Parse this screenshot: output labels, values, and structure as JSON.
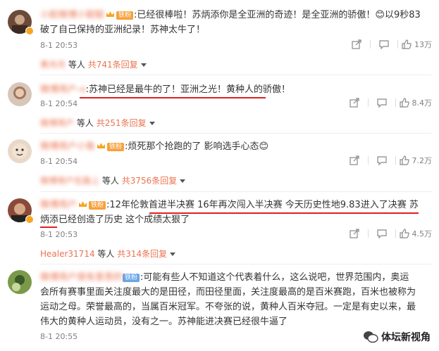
{
  "comments": [
    {
      "username": "小脸微博小聪聪",
      "fan_badge": "铁粉",
      "text": ":已经很棒啦！苏炳添你是全亚洲的奇迹！是全亚洲的骄傲！😊以9秒83破了自己保持的亚洲纪录！苏神太牛了！",
      "time": "8-1 20:53",
      "likes": "13万",
      "reply_user": "黄月月",
      "reply_text": "等人",
      "reply_count": "共741条回复"
    },
    {
      "username": "微博用户-o",
      "fan_badge": "",
      "text": ":苏神已经是最牛的了！亚洲之光！黄种人的骄傲！",
      "time": "8-1 20:54",
      "likes": "8.4万",
      "reply_user": "微博用户",
      "reply_text": "等人",
      "reply_count": "共251条回复"
    },
    {
      "username": "微博用户小鱼",
      "fan_badge": "铁粉",
      "text": ":烦死那个抢跑的了 影响选手心态😊",
      "time": "8-1 20:54",
      "likes": "7.2万",
      "reply_user": "微博用户在路上",
      "reply_text": "等人",
      "reply_count": "共3756条回复"
    },
    {
      "username": "微博用户",
      "fan_badge": "铁粉",
      "text": ":12年伦敦首进半决赛 16年再次闯入半决赛 今天历史性地9.83进入了决赛 苏炳添已经创造了历史 这个成绩太狠了",
      "time": "8-1 20:53",
      "likes": "4.5万",
      "reply_user": "Healer31714",
      "reply_text": "等人",
      "reply_count": "共314条回复"
    },
    {
      "username": "微博用户很有意思的",
      "fan_badge": "铁粉",
      "text": ":可能有些人不知道这个代表着什么，这么说吧，世界范围内，奥运会所有赛事里面关注度最大的是田径，而田径里面，关注度最高的是百米赛跑，百米也被称为运动之母。荣誉最高的，当属百米冠军。不夸张的说，黄种人百米夺冠。一定是有史以来，最伟大的黄种人运动员，没有之一。苏神能进决赛已经很牛逼了",
      "time": "8-1 20:55",
      "likes": ""
    }
  ],
  "watermark": "体坛新视角",
  "colors": {
    "username": "#eb7350",
    "text": "#333333",
    "meta": "#808080",
    "underline": "#e02020"
  }
}
